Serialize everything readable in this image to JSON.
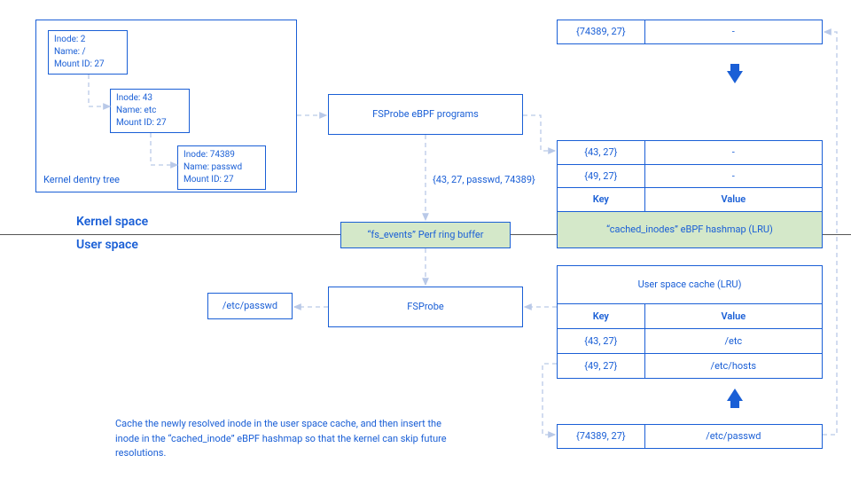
{
  "dentry_tree": {
    "label": "Kernel dentry tree",
    "node1": "Inode: 2\nName: /\nMount ID: 27",
    "node2": "Inode: 43\nName: etc\nMount ID: 27",
    "node3": "Inode: 74389\nName: passwd\nMount ID: 27"
  },
  "fsprobe_ebpf": "FSProbe eBPF programs",
  "event_tuple": "{43, 27, passwd, 74389}",
  "perf_buffer": "“fs_events” Perf ring buffer",
  "fsprobe_user": "FSProbe",
  "resolved": "/etc/passwd",
  "kernel_label": "Kernel space",
  "user_label": "User space",
  "cached_inodes": {
    "title": "“cached_inodes” eBPF hashmap (LRU)",
    "key_label": "Key",
    "value_label": "Value",
    "rows": [
      {
        "k": "{43, 27}",
        "v": "-"
      },
      {
        "k": "{49, 27}",
        "v": "-"
      }
    ],
    "new_row": {
      "k": "{74389, 27}",
      "v": "-"
    }
  },
  "user_cache": {
    "title": "User space cache (LRU)",
    "key_label": "Key",
    "value_label": "Value",
    "rows": [
      {
        "k": "{43, 27}",
        "v": "/etc"
      },
      {
        "k": "{49, 27}",
        "v": "/etc/hosts"
      }
    ],
    "new_row": {
      "k": "{74389, 27}",
      "v": "/etc/passwd"
    }
  },
  "caption": "Cache the newly resolved inode in the user space cache, and then insert the inode in the “cached_inode” eBPF hashmap so that the kernel can skip future resolutions."
}
